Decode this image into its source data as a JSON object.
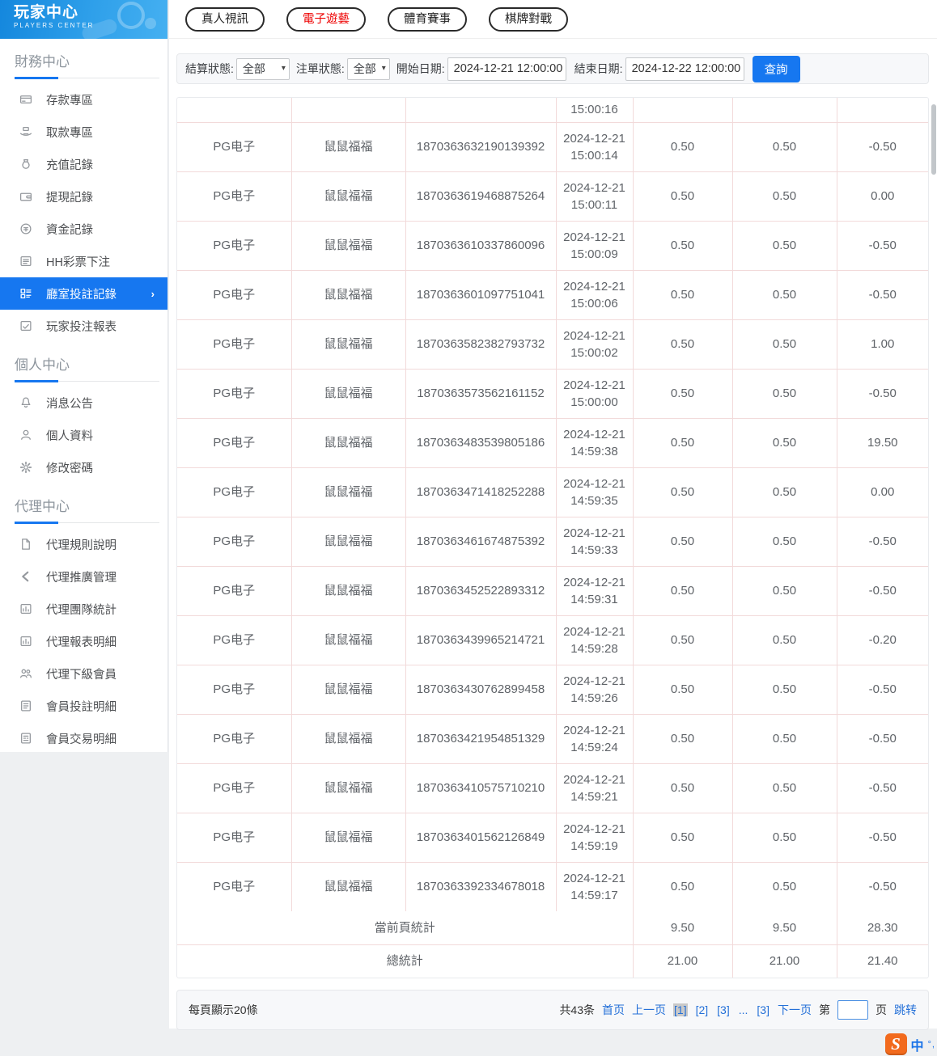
{
  "sidebar": {
    "title": "玩家中心",
    "subtitle": "PLAYERS CENTER",
    "sections": [
      {
        "label": "財務中心",
        "items": [
          {
            "icon": "card",
            "label": "存款專區"
          },
          {
            "icon": "hand",
            "label": "取款專區"
          },
          {
            "icon": "moneybag",
            "label": "充值記錄"
          },
          {
            "icon": "wallet",
            "label": "提現記錄"
          },
          {
            "icon": "coin",
            "label": "資金記錄"
          },
          {
            "icon": "list",
            "label": "HH彩票下注"
          },
          {
            "icon": "grid",
            "label": "廳室投註記錄",
            "active": true,
            "chevron": "›"
          },
          {
            "icon": "report",
            "label": "玩家投注報表"
          }
        ]
      },
      {
        "label": "個人中心",
        "items": [
          {
            "icon": "bell",
            "label": "消息公告"
          },
          {
            "icon": "person",
            "label": "個人資料"
          },
          {
            "icon": "gear",
            "label": "修改密碼"
          }
        ]
      },
      {
        "label": "代理中心",
        "items": [
          {
            "icon": "doc",
            "label": "代理規則說明"
          },
          {
            "icon": "share",
            "label": "代理推廣管理"
          },
          {
            "icon": "stats",
            "label": "代理團隊統計"
          },
          {
            "icon": "stats",
            "label": "代理報表明細"
          },
          {
            "icon": "users",
            "label": "代理下級會員"
          },
          {
            "icon": "clipboard",
            "label": "會員投註明細"
          },
          {
            "icon": "clipboard2",
            "label": "會員交易明細"
          }
        ]
      }
    ]
  },
  "tabs": [
    {
      "label": "真人視訊",
      "active": false
    },
    {
      "label": "電子遊藝",
      "active": true
    },
    {
      "label": "體育賽事",
      "active": false
    },
    {
      "label": "棋牌對戰",
      "active": false
    }
  ],
  "filters": {
    "settle_label": "結算狀態:",
    "settle_value": "全部",
    "order_label": "注單狀態:",
    "order_value": "全部",
    "start_label": "開始日期:",
    "start_value": "2024-12-21 12:00:00",
    "end_label": "結束日期:",
    "end_value": "2024-12-22 12:00:00",
    "search_label": "查詢"
  },
  "table": {
    "partial_time": "15:00:16",
    "rows": [
      {
        "platform": "PG电子",
        "game": "鼠鼠福福",
        "order_id": "1870363632190139392",
        "datetime": "2024-12-21 15:00:14",
        "bet": "0.50",
        "valid": "0.50",
        "result": "-0.50"
      },
      {
        "platform": "PG电子",
        "game": "鼠鼠福福",
        "order_id": "1870363619468875264",
        "datetime": "2024-12-21 15:00:11",
        "bet": "0.50",
        "valid": "0.50",
        "result": "0.00"
      },
      {
        "platform": "PG电子",
        "game": "鼠鼠福福",
        "order_id": "1870363610337860096",
        "datetime": "2024-12-21 15:00:09",
        "bet": "0.50",
        "valid": "0.50",
        "result": "-0.50"
      },
      {
        "platform": "PG电子",
        "game": "鼠鼠福福",
        "order_id": "1870363601097751041",
        "datetime": "2024-12-21 15:00:06",
        "bet": "0.50",
        "valid": "0.50",
        "result": "-0.50"
      },
      {
        "platform": "PG电子",
        "game": "鼠鼠福福",
        "order_id": "1870363582382793732",
        "datetime": "2024-12-21 15:00:02",
        "bet": "0.50",
        "valid": "0.50",
        "result": "1.00"
      },
      {
        "platform": "PG电子",
        "game": "鼠鼠福福",
        "order_id": "1870363573562161152",
        "datetime": "2024-12-21 15:00:00",
        "bet": "0.50",
        "valid": "0.50",
        "result": "-0.50"
      },
      {
        "platform": "PG电子",
        "game": "鼠鼠福福",
        "order_id": "1870363483539805186",
        "datetime": "2024-12-21 14:59:38",
        "bet": "0.50",
        "valid": "0.50",
        "result": "19.50"
      },
      {
        "platform": "PG电子",
        "game": "鼠鼠福福",
        "order_id": "1870363471418252288",
        "datetime": "2024-12-21 14:59:35",
        "bet": "0.50",
        "valid": "0.50",
        "result": "0.00"
      },
      {
        "platform": "PG电子",
        "game": "鼠鼠福福",
        "order_id": "1870363461674875392",
        "datetime": "2024-12-21 14:59:33",
        "bet": "0.50",
        "valid": "0.50",
        "result": "-0.50"
      },
      {
        "platform": "PG电子",
        "game": "鼠鼠福福",
        "order_id": "1870363452522893312",
        "datetime": "2024-12-21 14:59:31",
        "bet": "0.50",
        "valid": "0.50",
        "result": "-0.50"
      },
      {
        "platform": "PG电子",
        "game": "鼠鼠福福",
        "order_id": "1870363439965214721",
        "datetime": "2024-12-21 14:59:28",
        "bet": "0.50",
        "valid": "0.50",
        "result": "-0.20"
      },
      {
        "platform": "PG电子",
        "game": "鼠鼠福福",
        "order_id": "1870363430762899458",
        "datetime": "2024-12-21 14:59:26",
        "bet": "0.50",
        "valid": "0.50",
        "result": "-0.50"
      },
      {
        "platform": "PG电子",
        "game": "鼠鼠福福",
        "order_id": "1870363421954851329",
        "datetime": "2024-12-21 14:59:24",
        "bet": "0.50",
        "valid": "0.50",
        "result": "-0.50"
      },
      {
        "platform": "PG电子",
        "game": "鼠鼠福福",
        "order_id": "1870363410575710210",
        "datetime": "2024-12-21 14:59:21",
        "bet": "0.50",
        "valid": "0.50",
        "result": "-0.50"
      },
      {
        "platform": "PG电子",
        "game": "鼠鼠福福",
        "order_id": "1870363401562126849",
        "datetime": "2024-12-21 14:59:19",
        "bet": "0.50",
        "valid": "0.50",
        "result": "-0.50"
      },
      {
        "platform": "PG电子",
        "game": "鼠鼠福福",
        "order_id": "1870363392334678018",
        "datetime": "2024-12-21 14:59:17",
        "bet": "0.50",
        "valid": "0.50",
        "result": "-0.50"
      }
    ],
    "page_summary": {
      "label": "當前頁統計",
      "bet": "9.50",
      "valid": "9.50",
      "result": "28.30"
    },
    "total_summary": {
      "label": "總統計",
      "bet": "21.00",
      "valid": "21.00",
      "result": "21.40"
    }
  },
  "pagination": {
    "per_page": "每頁顯示20條",
    "total": "共43条",
    "first": "首页",
    "prev": "上一页",
    "pages": [
      {
        "label": "[1]",
        "current": true
      },
      {
        "label": "[2]",
        "current": false
      },
      {
        "label": "[3]",
        "current": false
      }
    ],
    "ellipsis": "...",
    "last_page": "[3]",
    "next": "下一页",
    "jump_prefix": "第",
    "jump_value": "",
    "jump_suffix": "页",
    "jump_action": "跳转"
  },
  "ime": {
    "logo": "S",
    "lang": "中",
    "marks": "°,"
  }
}
